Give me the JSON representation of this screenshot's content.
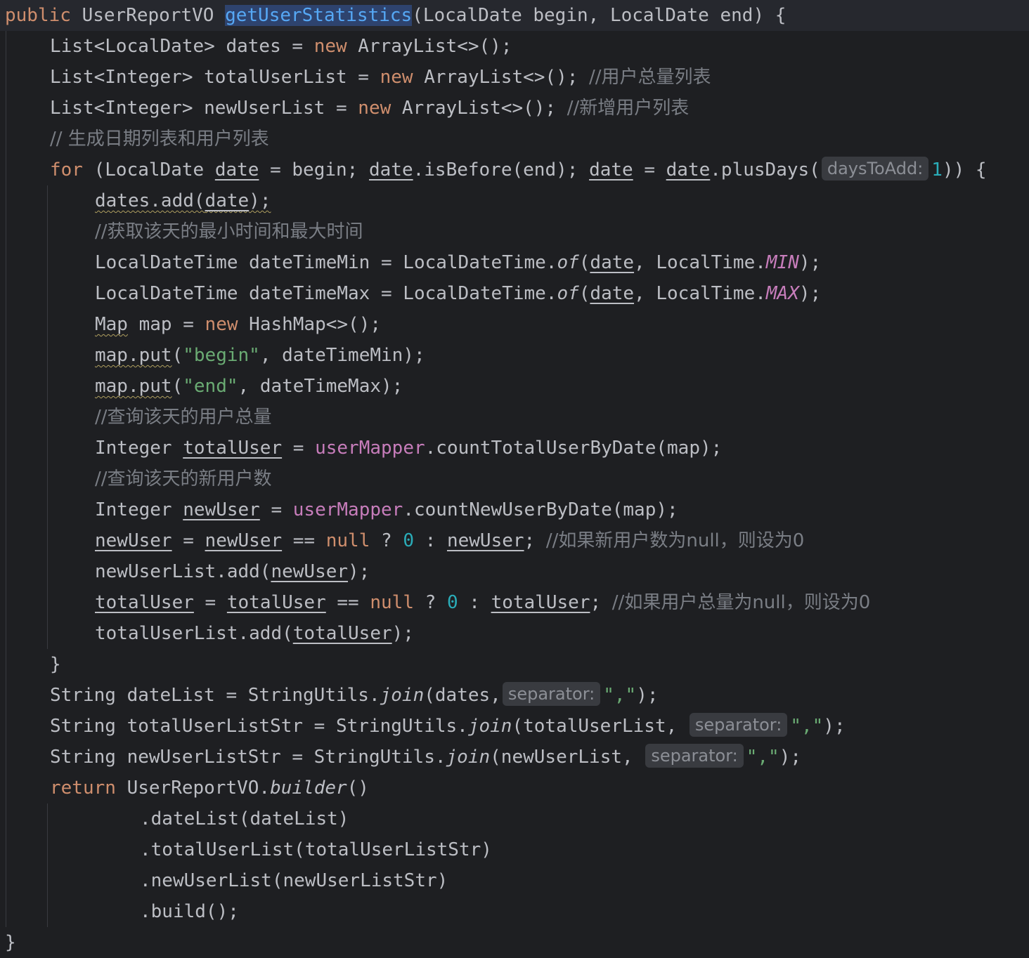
{
  "code": {
    "signature": {
      "kw_public": "public",
      "type": "UserReportVO",
      "method": "getUserStatistics",
      "params": "(LocalDate begin, LocalDate end) {"
    },
    "l2": {
      "t1": "List<LocalDate> dates = ",
      "kw": "new",
      "t2": " ArrayList<>();"
    },
    "l3": {
      "t1": "List<Integer> totalUserList = ",
      "kw": "new",
      "t2": " ArrayList<>(); ",
      "cmt": "//用户总量列表"
    },
    "l4": {
      "t1": "List<Integer> newUserList = ",
      "kw": "new",
      "t2": " ArrayList<>(); ",
      "cmt": "//新增用户列表"
    },
    "l5": {
      "cmt": "// 生成日期列表和用户列表"
    },
    "l6": {
      "kw": "for",
      "t1": " (LocalDate ",
      "v1": "date",
      "t2": " = begin; ",
      "v2": "date",
      "t3": ".isBefore(end); ",
      "v3": "date",
      "t4": " = ",
      "v4": "date",
      "t5": ".plusDays(",
      "hint": "daysToAdd:",
      "num": "1",
      "t6": ")) {"
    },
    "l7": {
      "t1": "dates.add(",
      "v1": "date",
      "t2": ");"
    },
    "l8": {
      "cmt": "//获取该天的最小时间和最大时间"
    },
    "l9": {
      "t1": "LocalDateTime dateTimeMin = LocalDateTime.",
      "st": "of",
      "t2": "(",
      "v1": "date",
      "t3": ", LocalTime.",
      "c": "MIN",
      "t4": ");"
    },
    "l10": {
      "t1": "LocalDateTime dateTimeMax = LocalDateTime.",
      "st": "of",
      "t2": "(",
      "v1": "date",
      "t3": ", LocalTime.",
      "c": "MAX",
      "t4": ");"
    },
    "l11": {
      "w": "Map",
      "t1": " map = ",
      "kw": "new",
      "t2": " HashMap<>();"
    },
    "l12": {
      "w": "map.put",
      "t1": "(",
      "s": "\"begin\"",
      "t2": ", dateTimeMin);"
    },
    "l13": {
      "w": "map.put",
      "t1": "(",
      "s": "\"end\"",
      "t2": ", dateTimeMax);"
    },
    "l14": {
      "cmt": "//查询该天的用户总量"
    },
    "l15": {
      "t1": "Integer ",
      "v1": "totalUser",
      "t2": " = ",
      "f": "userMapper",
      "t3": ".countTotalUserByDate(map);"
    },
    "l16": {
      "cmt": "//查询该天的新用户数"
    },
    "l17": {
      "t1": "Integer ",
      "v1": "newUser",
      "t2": " = ",
      "f": "userMapper",
      "t3": ".countNewUserByDate(map);"
    },
    "l18": {
      "v1": "newUser",
      "t1": " = ",
      "v2": "newUser",
      "t2": " == ",
      "kw": "null",
      "t3": " ? ",
      "num": "0",
      "t4": " : ",
      "v3": "newUser",
      "t5": "; ",
      "cmt": "//如果新用户数为null，则设为0"
    },
    "l19": {
      "t1": "newUserList.add(",
      "v1": "newUser",
      "t2": ");"
    },
    "l20": {
      "v1": "totalUser",
      "t1": " = ",
      "v2": "totalUser",
      "t2": " == ",
      "kw": "null",
      "t3": " ? ",
      "num": "0",
      "t4": " : ",
      "v3": "totalUser",
      "t5": "; ",
      "cmt": "//如果用户总量为null，则设为0"
    },
    "l21": {
      "t1": "totalUserList.add(",
      "v1": "totalUser",
      "t2": ");"
    },
    "l22": {
      "t1": "}"
    },
    "l23": {
      "t1": "String dateList = StringUtils.",
      "st": "join",
      "t2": "(dates,",
      "hint": "separator:",
      "s": "\",\"",
      "t3": ");"
    },
    "l24": {
      "t1": "String totalUserListStr = StringUtils.",
      "st": "join",
      "t2": "(totalUserList, ",
      "hint": "separator:",
      "s": "\",\"",
      "t3": ");"
    },
    "l25": {
      "t1": "String newUserListStr = StringUtils.",
      "st": "join",
      "t2": "(newUserList, ",
      "hint": "separator:",
      "s": "\",\"",
      "t3": ");"
    },
    "l26": {
      "kw": "return",
      "t1": " UserReportVO.",
      "st": "builder",
      "t2": "()"
    },
    "l27": {
      "t1": ".dateList(dateList)"
    },
    "l28": {
      "t1": ".totalUserList(totalUserListStr)"
    },
    "l29": {
      "t1": ".newUserList(newUserListStr)"
    },
    "l30": {
      "t1": ".build();"
    },
    "l31": {
      "t1": "}"
    }
  },
  "colors": {
    "background": "#1e1f22",
    "keyword": "#cf8e6d",
    "method_highlight": "#56a8f5",
    "string": "#6aab73",
    "number": "#2aacb8",
    "comment": "#7a7e85",
    "field": "#c77dbb"
  }
}
